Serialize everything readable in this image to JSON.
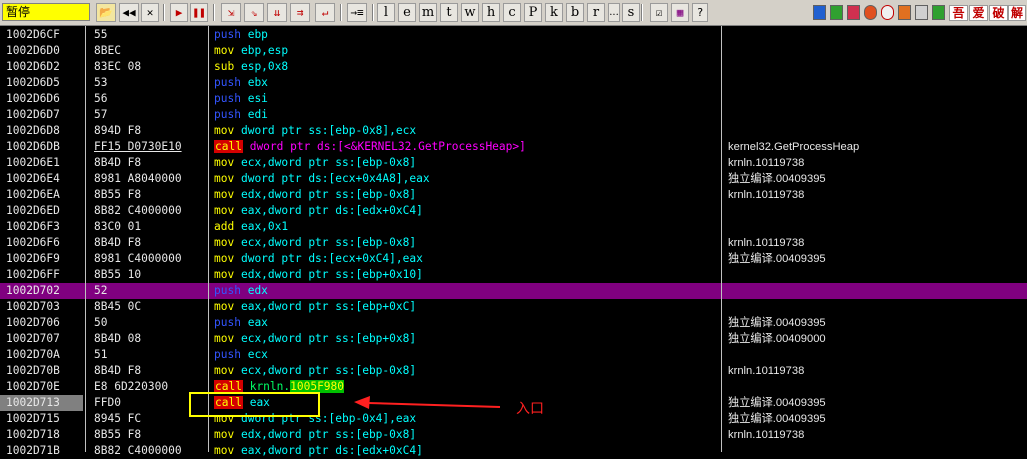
{
  "toolbar": {
    "status": "暂停",
    "letters": [
      "l",
      "e",
      "m",
      "t",
      "w",
      "h",
      "c",
      "P",
      "k",
      "b",
      "r",
      "...",
      "s"
    ],
    "right_text": [
      "吾",
      "爱",
      "破",
      "解"
    ],
    "help": "?"
  },
  "rows": [
    {
      "addr": "1002D6CF",
      "hex": "55",
      "mn": "push",
      "ops": "ebp",
      "cmt": ""
    },
    {
      "addr": "1002D6D0",
      "hex": "8BEC",
      "mn": "mov",
      "ops": "ebp,esp",
      "cmt": ""
    },
    {
      "addr": "1002D6D2",
      "hex": "83EC 08",
      "mn": "sub",
      "ops": "esp,0x8",
      "cmt": ""
    },
    {
      "addr": "1002D6D5",
      "hex": "53",
      "mn": "push",
      "ops": "ebx",
      "cmt": ""
    },
    {
      "addr": "1002D6D6",
      "hex": "56",
      "mn": "push",
      "ops": "esi",
      "cmt": ""
    },
    {
      "addr": "1002D6D7",
      "hex": "57",
      "mn": "push",
      "ops": "edi",
      "cmt": ""
    },
    {
      "addr": "1002D6D8",
      "hex": "894D F8",
      "mn": "mov",
      "ops": "dword ptr ss:[ebp-0x8],ecx",
      "cmt": ""
    },
    {
      "addr": "1002D6DB",
      "hex": "FF15 D0730E10",
      "mn": "call",
      "ops": "dword ptr ds:[<&KERNEL32.GetProcessHeap>]",
      "cmt": "kernel32.GetProcessHeap"
    },
    {
      "addr": "1002D6E1",
      "hex": "8B4D F8",
      "mn": "mov",
      "ops": "ecx,dword ptr ss:[ebp-0x8]",
      "cmt": "krnln.10119738"
    },
    {
      "addr": "1002D6E4",
      "hex": "8981 A8040000",
      "mn": "mov",
      "ops": "dword ptr ds:[ecx+0x4A8],eax",
      "cmt": "独立编译.00409395"
    },
    {
      "addr": "1002D6EA",
      "hex": "8B55 F8",
      "mn": "mov",
      "ops": "edx,dword ptr ss:[ebp-0x8]",
      "cmt": "krnln.10119738"
    },
    {
      "addr": "1002D6ED",
      "hex": "8B82 C4000000",
      "mn": "mov",
      "ops": "eax,dword ptr ds:[edx+0xC4]",
      "cmt": ""
    },
    {
      "addr": "1002D6F3",
      "hex": "83C0 01",
      "mn": "add",
      "ops": "eax,0x1",
      "cmt": ""
    },
    {
      "addr": "1002D6F6",
      "hex": "8B4D F8",
      "mn": "mov",
      "ops": "ecx,dword ptr ss:[ebp-0x8]",
      "cmt": "krnln.10119738"
    },
    {
      "addr": "1002D6F9",
      "hex": "8981 C4000000",
      "mn": "mov",
      "ops": "dword ptr ds:[ecx+0xC4],eax",
      "cmt": "独立编译.00409395"
    },
    {
      "addr": "1002D6FF",
      "hex": "8B55 10",
      "mn": "mov",
      "ops": "edx,dword ptr ss:[ebp+0x10]",
      "cmt": ""
    },
    {
      "addr": "1002D702",
      "hex": "52",
      "mn": "push",
      "ops": "edx",
      "cmt": ""
    },
    {
      "addr": "1002D703",
      "hex": "8B45 0C",
      "mn": "mov",
      "ops": "eax,dword ptr ss:[ebp+0xC]",
      "cmt": ""
    },
    {
      "addr": "1002D706",
      "hex": "50",
      "mn": "push",
      "ops": "eax",
      "cmt": "独立编译.00409395"
    },
    {
      "addr": "1002D707",
      "hex": "8B4D 08",
      "mn": "mov",
      "ops": "ecx,dword ptr ss:[ebp+0x8]",
      "cmt": "独立编译.00409000"
    },
    {
      "addr": "1002D70A",
      "hex": "51",
      "mn": "push",
      "ops": "ecx",
      "cmt": ""
    },
    {
      "addr": "1002D70B",
      "hex": "8B4D F8",
      "mn": "mov",
      "ops": "ecx,dword ptr ss:[ebp-0x8]",
      "cmt": "krnln.10119738"
    },
    {
      "addr": "1002D70E",
      "hex": "E8 6D220300",
      "mn": "call",
      "ops": "krnln.1005F980",
      "cmt": ""
    },
    {
      "addr": "1002D713",
      "hex": "FFD0",
      "mn": "call",
      "ops": "eax",
      "cmt": "独立编译.00409395"
    },
    {
      "addr": "1002D715",
      "hex": "8945 FC",
      "mn": "mov",
      "ops": "dword ptr ss:[ebp-0x4],eax",
      "cmt": "独立编译.00409395"
    },
    {
      "addr": "1002D718",
      "hex": "8B55 F8",
      "mn": "mov",
      "ops": "edx,dword ptr ss:[ebp-0x8]",
      "cmt": "krnln.10119738"
    },
    {
      "addr": "1002D71B",
      "hex": "8B82 C4000000",
      "mn": "mov",
      "ops": "eax,dword ptr ds:[edx+0xC4]",
      "cmt": ""
    }
  ],
  "annotation": {
    "label": "入口"
  },
  "colors": {
    "mnemonic": "#ffff00",
    "push": "#3355ff",
    "call_bg": "#d40000",
    "operand": "#00ffff",
    "selected_row": "#800080",
    "annotation": "#ff2020"
  }
}
